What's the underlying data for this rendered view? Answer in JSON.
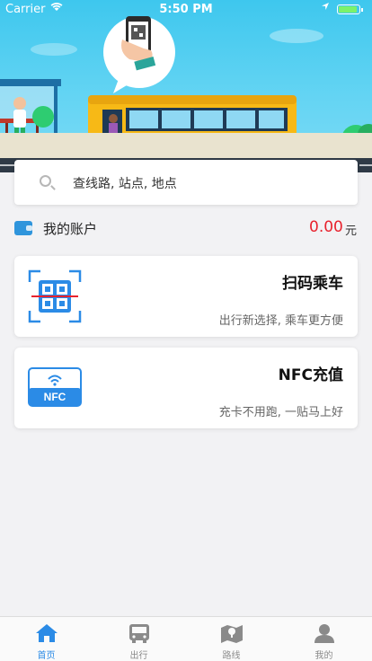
{
  "status_bar": {
    "carrier": "Carrier",
    "time": "5:50 PM"
  },
  "search": {
    "placeholder": "查线路, 站点, 地点"
  },
  "account": {
    "label": "我的账户",
    "balance": "0.00",
    "unit": "元"
  },
  "cards": [
    {
      "title": "扫码乘车",
      "subtitle": "出行新选择, 乘车更方便",
      "icon": "qr-scan-icon"
    },
    {
      "title": "NFC充值",
      "subtitle": "充卡不用跑, 一贴马上好",
      "icon": "nfc-card-icon",
      "icon_text": "NFC"
    }
  ],
  "tabs": [
    {
      "label": "首页",
      "icon": "home-icon",
      "active": true
    },
    {
      "label": "出行",
      "icon": "bus-icon",
      "active": false
    },
    {
      "label": "路线",
      "icon": "map-icon",
      "active": false
    },
    {
      "label": "我的",
      "icon": "profile-icon",
      "active": false
    }
  ],
  "colors": {
    "accent": "#2b8be6",
    "balance": "#e8222d",
    "sky": "#3ec7ee",
    "bus": "#f7b916"
  }
}
